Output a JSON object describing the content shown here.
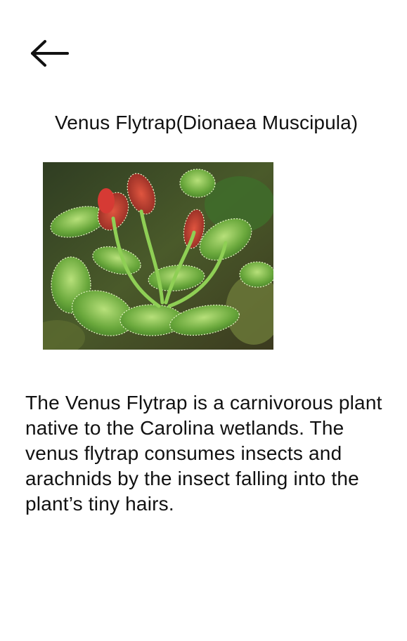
{
  "header": {
    "back_icon": "arrow-left-icon"
  },
  "main": {
    "title": "Venus Flytrap(Dionaea Muscipula)",
    "photo": {
      "subject": "venus-flytrap-plant"
    },
    "description": "The Venus Flytrap is a carnivorous plant native to the Carolina wetlands.  The venus flytrap consumes insects and arachnids by the insect falling into the plant’s tiny hairs."
  },
  "colors": {
    "text": "#111111",
    "background": "#ffffff",
    "leaf_green": "#5f9f3a",
    "trap_red": "#c4362f",
    "soil": "#3a3320"
  }
}
